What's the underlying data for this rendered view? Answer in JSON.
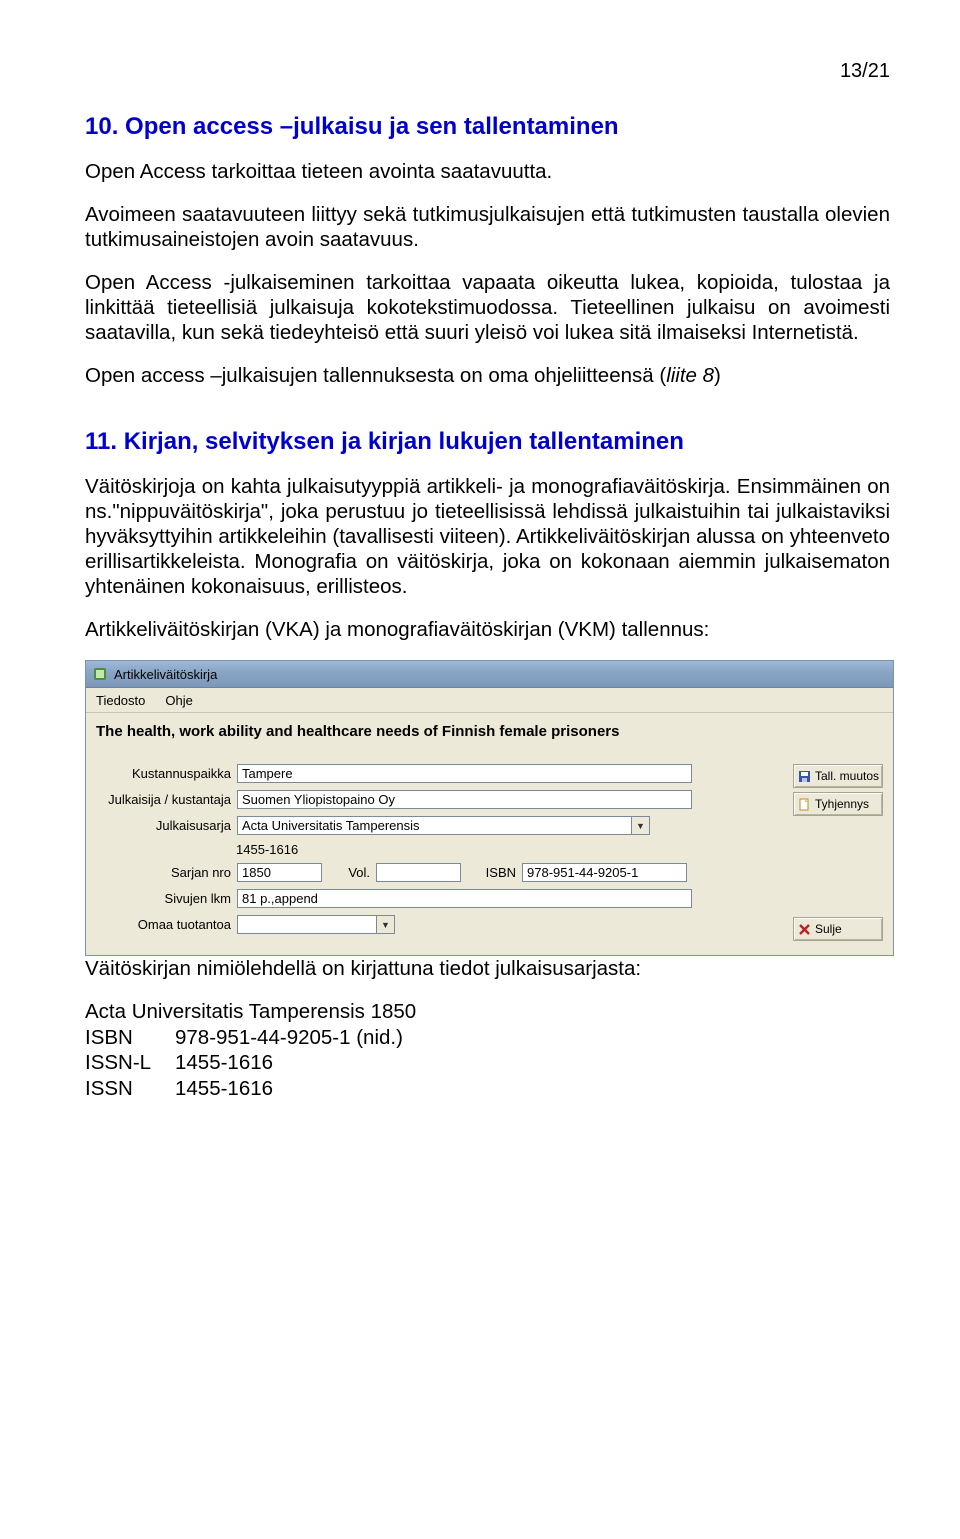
{
  "pagenum": "13/21",
  "section10": {
    "heading": "10. Open access –julkaisu ja sen tallentaminen",
    "para1": "Open Access tarkoittaa tieteen avointa saatavuutta.",
    "para2": "Avoimeen saatavuuteen liittyy sekä tutkimusjulkaisujen että tutkimusten taustalla olevien tutkimusaineistojen avoin saatavuus.",
    "para3": "Open Access -julkaiseminen tarkoittaa vapaata oikeutta lukea, kopioida, tulostaa ja linkittää tieteellisiä julkaisuja kokotekstimuodossa. Tieteellinen julkaisu on avoimesti saatavilla, kun sekä tiedeyhteisö että suuri yleisö voi lukea sitä ilmaiseksi Internetistä.",
    "para4_prefix": "Open access  –julkaisujen tallennuksesta on oma ohjeliitteensä (",
    "para4_liite": "liite 8",
    "para4_suffix": ")"
  },
  "section11": {
    "heading": "11. Kirjan, selvityksen ja kirjan lukujen tallentaminen",
    "para1": "Väitöskirjoja on kahta julkaisutyyppiä artikkeli- ja monografiaväitöskirja. Ensimmäinen on ns.\"nippuväitöskirja\", joka perustuu jo tieteellisissä lehdissä julkaistuihin tai julkaistaviksi hyväksyttyihin artikkeleihin (tavallisesti viiteen). Artikkeliväitöskirjan alussa on yhteenveto erillisartikkeleista. Monografia on väitöskirja, joka on kokonaan aiemmin julkaisematon yhtenäinen kokonaisuus, erillisteos.",
    "para2": "Artikkeliväitöskirjan (VKA) ja monografiaväitöskirjan (VKM) tallennus:"
  },
  "app": {
    "title": "Artikkeliväitöskirja",
    "menu_file": "Tiedosto",
    "menu_help": "Ohje",
    "headline": "The health, work ability and healthcare needs of Finnish female prisoners",
    "labels": {
      "kustannuspaikka": "Kustannuspaikka",
      "julkaisija": "Julkaisija / kustantaja",
      "julkaisusarja": "Julkaisusarja",
      "sarjan_nro": "Sarjan nro",
      "vol": "Vol.",
      "isbn": "ISBN",
      "sivujen_lkm": "Sivujen lkm",
      "omaa_tuotantoa": "Omaa tuotantoa"
    },
    "values": {
      "kustannuspaikka": "Tampere",
      "julkaisija": "Suomen Yliopistopaino Oy",
      "julkaisusarja": "Acta Universitatis Tamperensis",
      "issn_static": "1455-1616",
      "sarjan_nro": "1850",
      "vol": "",
      "isbn": "978-951-44-9205-1",
      "sivujen_lkm": "81 p.,append",
      "omaa_tuotantoa": ""
    },
    "buttons": {
      "save": "Tall. muutos",
      "clear": "Tyhjennys",
      "close": "Sulje"
    }
  },
  "below": {
    "line": "Väitöskirjan nimiölehdellä on kirjattuna tiedot julkaisusarjasta:",
    "r1": "Acta Universitatis Tamperensis 1850",
    "r2a": "ISBN",
    "r2b": "978-951-44-9205-1 (nid.)",
    "r3a": "ISSN-L",
    "r3b": "1455-1616",
    "r4a": "ISSN",
    "r4b": "1455-1616"
  }
}
